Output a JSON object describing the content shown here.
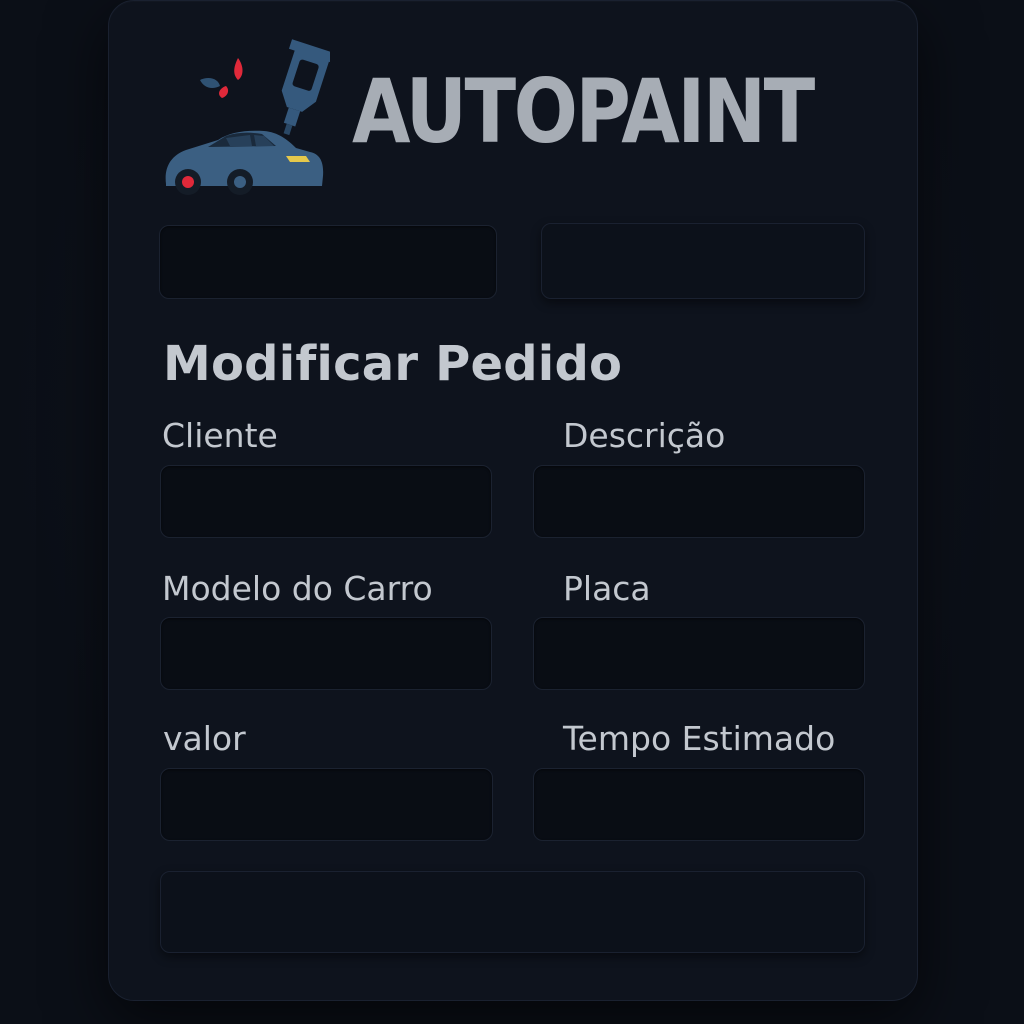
{
  "brand": {
    "name": "AUTOPAINT",
    "logo_icon": "car-paint-gun-icon",
    "text_color": "#a7adb5",
    "logo_colors": {
      "car_body": "#3b5f82",
      "splash": "#e0293a",
      "paint_gun": "#35597d",
      "headlight": "#e5c84b"
    }
  },
  "top_controls": {
    "left_value": "",
    "right_button_label": ""
  },
  "form": {
    "title": "Modificar Pedido",
    "fields": {
      "cliente": {
        "label": "Cliente",
        "value": ""
      },
      "descricao": {
        "label": "Descrição",
        "value": ""
      },
      "modelo": {
        "label": "Modelo do Carro",
        "value": ""
      },
      "placa": {
        "label": "Placa",
        "value": ""
      },
      "valor": {
        "label": "valor",
        "value": ""
      },
      "tempo": {
        "label": "Tempo Estimado",
        "value": ""
      }
    },
    "submit_label": ""
  },
  "colors": {
    "background": "#0b0f17",
    "card": "#0e131d",
    "input": "#090d14",
    "text": "#c3c8cf"
  }
}
